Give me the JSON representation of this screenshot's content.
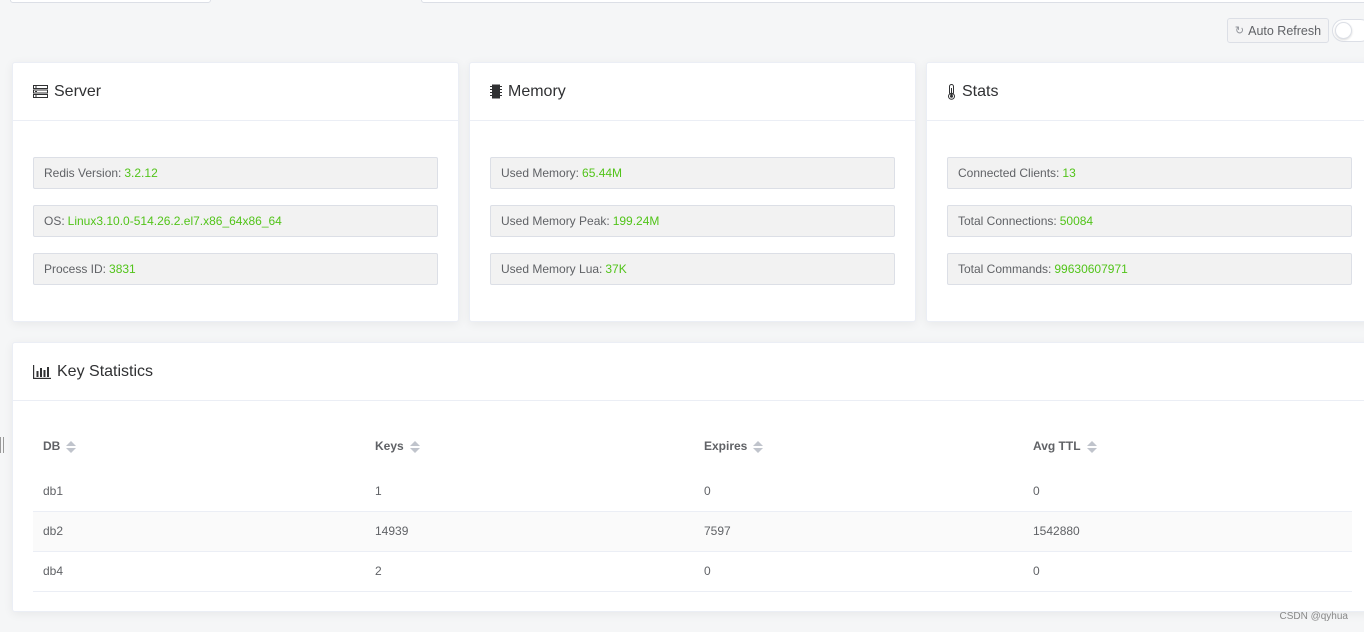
{
  "toolbar": {
    "auto_refresh_label": "Auto Refresh",
    "auto_refresh_icon": "refresh-icon",
    "auto_refresh_enabled": false
  },
  "server": {
    "title": "Server",
    "icon": "server-icon",
    "rows": [
      {
        "label": "Redis Version:",
        "value": "3.2.12"
      },
      {
        "label": "OS:",
        "value": "Linux3.10.0-514.26.2.el7.x86_64x86_64"
      },
      {
        "label": "Process ID:",
        "value": "3831"
      }
    ]
  },
  "memory": {
    "title": "Memory",
    "icon": "memory-chip-icon",
    "rows": [
      {
        "label": "Used Memory:",
        "value": "65.44M"
      },
      {
        "label": "Used Memory Peak:",
        "value": "199.24M"
      },
      {
        "label": "Used Memory Lua:",
        "value": "37K"
      }
    ]
  },
  "stats": {
    "title": "Stats",
    "icon": "thermometer-icon",
    "rows": [
      {
        "label": "Connected Clients:",
        "value": "13"
      },
      {
        "label": "Total Connections:",
        "value": "50084"
      },
      {
        "label": "Total Commands:",
        "value": "99630607971"
      }
    ]
  },
  "key_statistics": {
    "title": "Key Statistics",
    "icon": "bar-chart-icon",
    "columns": [
      "DB",
      "Keys",
      "Expires",
      "Avg TTL"
    ],
    "rows": [
      [
        "db1",
        "1",
        "0",
        "0"
      ],
      [
        "db2",
        "14939",
        "7597",
        "1542880"
      ],
      [
        "db4",
        "2",
        "0",
        "0"
      ]
    ]
  },
  "watermark": "CSDN @qyhua",
  "colors": {
    "value_green": "#52c41a",
    "border": "#dcdfe6"
  }
}
